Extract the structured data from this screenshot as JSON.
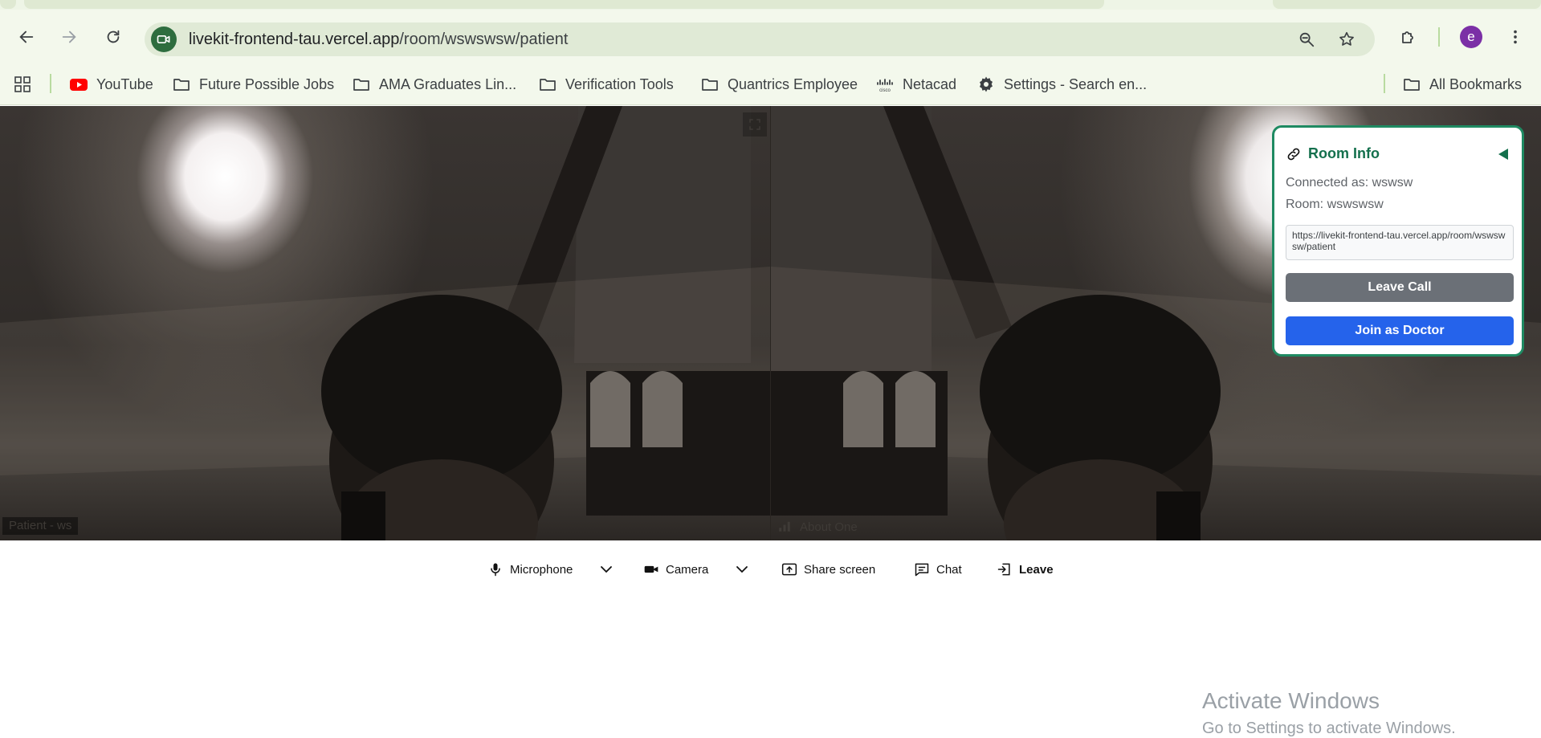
{
  "browser": {
    "url_host": "livekit-frontend-tau.vercel.app",
    "url_path": "/room/wswswsw/patient",
    "profile_initial": "e",
    "bookmarks": [
      {
        "label": "YouTube",
        "icon": "youtube-icon"
      },
      {
        "label": "Future Possible Jobs",
        "icon": "folder-icon"
      },
      {
        "label": "AMA Graduates Lin...",
        "icon": "folder-icon"
      },
      {
        "label": "Verification Tools",
        "icon": "folder-icon"
      },
      {
        "label": "Quantrics Employee",
        "icon": "folder-icon"
      },
      {
        "label": "Netacad",
        "icon": "cisco-icon"
      },
      {
        "label": "Settings - Search en...",
        "icon": "gear-icon"
      }
    ],
    "all_bookmarks": "All Bookmarks"
  },
  "video": {
    "tiles": [
      {
        "label": "Patient - ws"
      },
      {
        "label": "About One"
      }
    ]
  },
  "room_info": {
    "title": "Room Info",
    "connected_as": "Connected as: wswsw",
    "room": "Room: wswswsw",
    "link": "https://livekit-frontend-tau.vercel.app/room/wswswsw/patient",
    "leave_call": "Leave Call",
    "join_doctor": "Join as Doctor",
    "accent": "#1f8a62",
    "primary": "#2563eb"
  },
  "controls": {
    "microphone": "Microphone",
    "camera": "Camera",
    "share_screen": "Share screen",
    "chat": "Chat",
    "leave": "Leave"
  },
  "watermark": {
    "title": "Activate Windows",
    "subtitle": "Go to Settings to activate Windows."
  }
}
